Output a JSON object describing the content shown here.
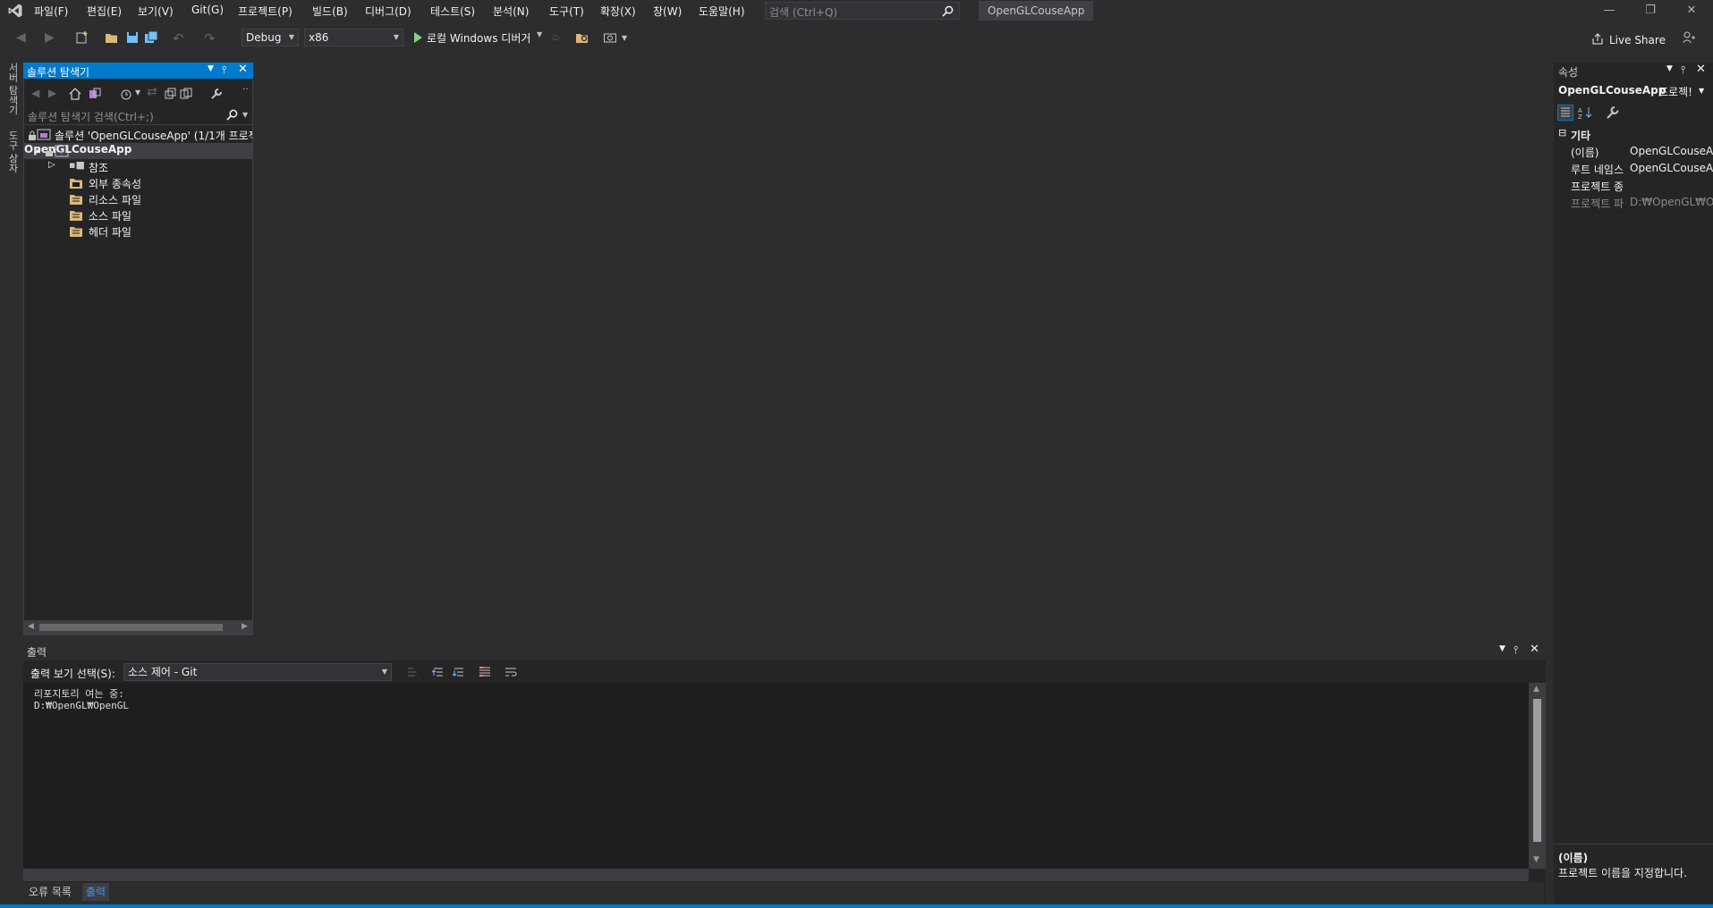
{
  "menubar": {
    "items": [
      "파일(F)",
      "편집(E)",
      "보기(V)",
      "Git(G)",
      "프로젝트(P)",
      "빌드(B)",
      "디버그(D)",
      "테스트(S)",
      "분석(N)",
      "도구(T)",
      "확장(X)",
      "창(W)",
      "도움말(H)"
    ],
    "search_placeholder": "검색 (Ctrl+Q)",
    "app_title": "OpenGLCouseApp"
  },
  "toolbar": {
    "config": "Debug",
    "platform": "x86",
    "run_label": "로컬 Windows 디버거",
    "live_share": "Live Share"
  },
  "left_tabs": {
    "server_explorer": "서버 탐색기",
    "toolbox": "도구 상자"
  },
  "solution_explorer": {
    "title": "솔루션 탐색기",
    "search_placeholder": "솔루션 탐색기 검색(Ctrl+;)",
    "solution": "솔루션 'OpenGLCouseApp' (1/1개 프로젝",
    "project": "OpenGLCouseApp",
    "nodes": [
      "참조",
      "외부 종속성",
      "리소스 파일",
      "소스 파일",
      "헤더 파일"
    ]
  },
  "properties": {
    "title": "속성",
    "object": "OpenGLCouseApp",
    "object_type": "프로젝!",
    "category": "기타",
    "rows": [
      {
        "name": "(이름)",
        "value": "OpenGLCouseA"
      },
      {
        "name": "루트 네임스",
        "value": "OpenGLCouseA"
      },
      {
        "name": "프로젝트 종",
        "value": ""
      },
      {
        "name": "프로젝트 파",
        "value": "D:₩OpenGL₩Op"
      }
    ],
    "desc_title": "(이름)",
    "desc_text": "프로젝트 이름을 지정합니다."
  },
  "output": {
    "title": "출력",
    "show_label": "출력 보기 선택(S):",
    "source": "소스 제어 - Git",
    "lines": [
      "리포지토리 여는 중:",
      "D:₩OpenGL₩OpenGL"
    ]
  },
  "bottom_tabs": [
    "오류 목록",
    "출력"
  ],
  "colors": {
    "accent": "#007acc",
    "background": "#2d2d30",
    "panel": "#252526"
  }
}
